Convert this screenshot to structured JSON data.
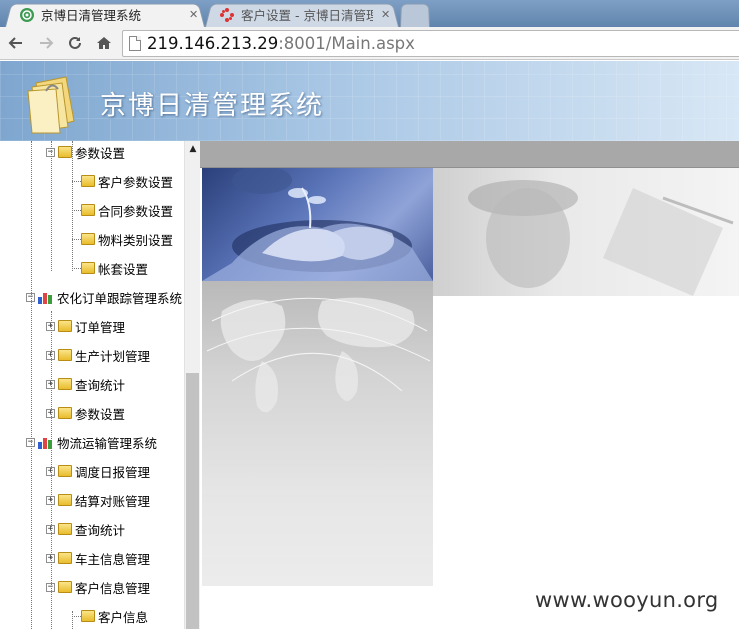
{
  "browser": {
    "tabs": [
      {
        "title": "京博日清管理系统",
        "active": true,
        "close": "✕"
      },
      {
        "title": "客户设置 - 京博日清管理系",
        "active": false,
        "close": "✕"
      }
    ],
    "address": {
      "host": "219.146.213.29",
      "rest": ":8001/Main.aspx"
    }
  },
  "app": {
    "title": "京博日清管理系统"
  },
  "tree": [
    {
      "label": "参数设置",
      "icon": "folder-icon",
      "expander": "−",
      "level": 1
    },
    {
      "label": "客户参数设置",
      "icon": "folder-icon",
      "level": 2
    },
    {
      "label": "合同参数设置",
      "icon": "folder-icon",
      "level": 2
    },
    {
      "label": "物料类别设置",
      "icon": "folder-icon",
      "level": 2
    },
    {
      "label": "帐套设置",
      "icon": "folder-icon",
      "level": 2
    },
    {
      "label": "农化订单跟踪管理系统",
      "icon": "bar-chart-icon",
      "expander": "−",
      "level": 0
    },
    {
      "label": "订单管理",
      "icon": "folder-icon",
      "expander": "+",
      "level": 1
    },
    {
      "label": "生产计划管理",
      "icon": "folder-icon",
      "expander": "+",
      "level": 1
    },
    {
      "label": "查询统计",
      "icon": "folder-icon",
      "expander": "+",
      "level": 1
    },
    {
      "label": "参数设置",
      "icon": "folder-icon",
      "expander": "+",
      "level": 1
    },
    {
      "label": "物流运输管理系统",
      "icon": "bar-chart-icon",
      "expander": "−",
      "level": 0
    },
    {
      "label": "调度日报管理",
      "icon": "folder-icon",
      "expander": "+",
      "level": 1
    },
    {
      "label": "结算对账管理",
      "icon": "folder-icon",
      "expander": "+",
      "level": 1
    },
    {
      "label": "查询统计",
      "icon": "folder-icon",
      "expander": "+",
      "level": 1
    },
    {
      "label": "车主信息管理",
      "icon": "folder-icon",
      "expander": "+",
      "level": 1
    },
    {
      "label": "客户信息管理",
      "icon": "folder-icon",
      "expander": "−",
      "level": 1
    },
    {
      "label": "客户信息",
      "icon": "folder-icon",
      "level": 2
    }
  ],
  "watermark": "www.wooyun.org",
  "colors": {
    "banner": "#8fb3d9",
    "sidebar_line": "#9a9a9a",
    "topbar": "#a8a8a8"
  }
}
